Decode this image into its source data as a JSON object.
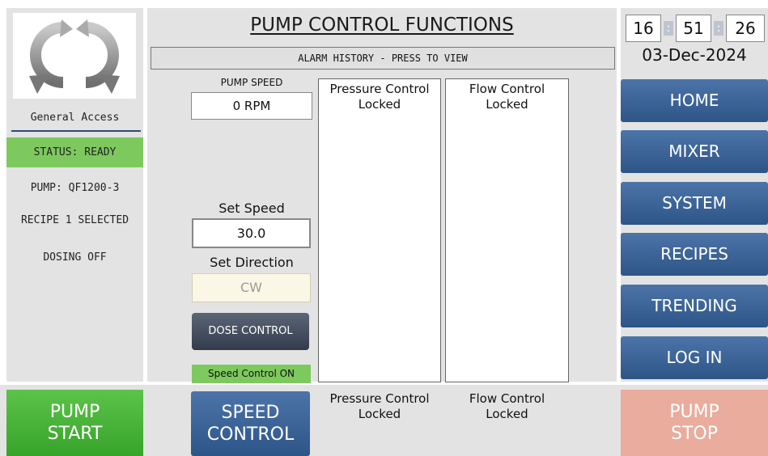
{
  "left": {
    "access_level": "General Access",
    "status": "STATUS: READY",
    "pump": "PUMP: QF1200-3",
    "recipe": "RECIPE 1 SELECTED",
    "dosing": "DOSING OFF"
  },
  "center": {
    "title": "PUMP CONTROL FUNCTIONS",
    "alarm_history": "ALARM HISTORY - PRESS TO VIEW",
    "pump_speed_label": "PUMP SPEED",
    "pump_speed_value": "0 RPM",
    "set_speed_label": "Set Speed",
    "set_speed_value": "30.0",
    "set_direction_label": "Set Direction",
    "set_direction_value": "CW",
    "dose_control_label": "DOSE CONTROL",
    "speed_control_status": "Speed Control ON",
    "pressure_box": {
      "title": "Pressure Control",
      "state": "Locked"
    },
    "flow_box": {
      "title": "Flow Control",
      "state": "Locked"
    }
  },
  "right": {
    "clock": {
      "hours": "16",
      "minutes": "51",
      "seconds": "26",
      "separator": ":"
    },
    "date": "03-Dec-2024",
    "nav": [
      "HOME",
      "MIXER",
      "SYSTEM",
      "RECIPES",
      "TRENDING",
      "LOG IN"
    ]
  },
  "bottom": {
    "pump_start": [
      "PUMP",
      "START"
    ],
    "speed_control": [
      "SPEED",
      "CONTROL"
    ],
    "pressure": {
      "title": "Pressure Control",
      "state": "Locked"
    },
    "flow": {
      "title": "Flow Control",
      "state": "Locked"
    },
    "pump_stop": [
      "PUMP",
      "STOP"
    ]
  },
  "colors": {
    "ready_green": "#7dc95e",
    "nav_blue": "#2d5588",
    "start_green": "#37a42a",
    "stop_disabled": "#e9ac9d",
    "panel_gray": "#e3e3e3"
  },
  "icons": {
    "logo": "circular-arrows-logo-icon"
  }
}
